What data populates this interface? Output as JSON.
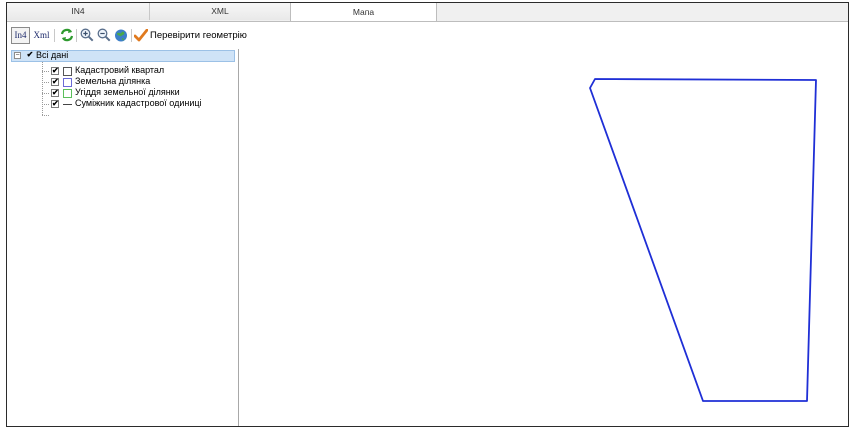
{
  "tabs": [
    {
      "label": "IN4"
    },
    {
      "label": "XML"
    },
    {
      "label": "Мапа"
    }
  ],
  "toolbar": {
    "in4_label": "In4",
    "xml_label": "Xml",
    "check_geometry_label": "Перевірити геометрію",
    "icons": [
      "refresh-icon",
      "zoom-in-icon",
      "zoom-out-icon",
      "globe-icon",
      "checkmark-icon"
    ]
  },
  "tree": {
    "root_label": "Всі дані",
    "items": [
      {
        "label": "Кадастровий квартал",
        "symbol": "square",
        "color": "#555555"
      },
      {
        "label": "Земельна ділянка",
        "symbol": "square",
        "color": "#6a6ad6"
      },
      {
        "label": "Угіддя земельної ділянки",
        "symbol": "square",
        "color": "#5bbf5b"
      },
      {
        "label": "Суміжник кадастрової одиниці",
        "symbol": "line",
        "color": "#444444"
      }
    ]
  },
  "map": {
    "parcel_color": "#1f2fd6"
  }
}
